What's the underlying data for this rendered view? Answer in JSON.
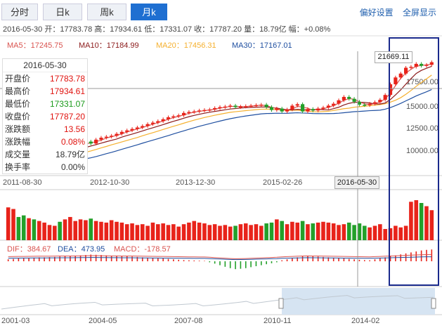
{
  "tabs": [
    {
      "label": "分时",
      "active": false
    },
    {
      "label": "日k",
      "active": false
    },
    {
      "label": "周k",
      "active": false
    },
    {
      "label": "月k",
      "active": true
    }
  ],
  "links": {
    "settings": "偏好设置",
    "fullscreen": "全屏显示"
  },
  "info_line": "2016-05-30 开：17783.78 高：17934.61 低：17331.07 收：17787.20 量：18.79亿 幅：+0.08%",
  "ma": {
    "ma5": "MA5：17245.75",
    "ma10": "MA10：17184.99",
    "ma20": "MA20：17456.31",
    "ma30": "MA30：17167.01"
  },
  "ohlc": {
    "date": "2016-05-30",
    "rows": [
      {
        "label": "开盘价",
        "value": "17783.78",
        "tone": "red"
      },
      {
        "label": "最高价",
        "value": "17934.61",
        "tone": "red"
      },
      {
        "label": "最低价",
        "value": "17331.07",
        "tone": "green"
      },
      {
        "label": "收盘价",
        "value": "17787.20",
        "tone": "red"
      },
      {
        "label": "涨跌额",
        "value": "13.56",
        "tone": "red"
      },
      {
        "label": "涨跌幅",
        "value": "0.08%",
        "tone": "red"
      },
      {
        "label": "成交量",
        "value": "18.79亿",
        "tone": "plain"
      },
      {
        "label": "换手率",
        "value": "0.00%",
        "tone": "plain"
      }
    ]
  },
  "macd": {
    "dif": "DIF：384.67",
    "dea": "DEA：473.95",
    "macd": "MACD：-178.57"
  },
  "cursor_date": "2016-05-30",
  "price_tag": "21669.11",
  "colors": {
    "up": "#e8231a",
    "down": "#23a02a",
    "ma5": "#d9534f",
    "ma10": "#8b1a1a",
    "ma20": "#f5b02e",
    "ma30": "#1f4fa0",
    "highlight": "#1a2a8c",
    "accent": "#1f6fd1"
  },
  "chart_data": {
    "type": "candlestick",
    "y_ticks": [
      "15000.00",
      "12500.00",
      "10000.00",
      "17500.00"
    ],
    "x_ticks": [
      "2011-08-30",
      "2012-10-30",
      "2013-12-30",
      "2015-02-26",
      "2016-05-30"
    ],
    "nav_ticks": [
      "2001-03",
      "2004-05",
      "2007-08",
      "2010-11",
      "2014-02"
    ],
    "ylim": [
      10000,
      22000
    ],
    "closes": [
      11650,
      11700,
      11600,
      11550,
      11900,
      11800,
      12000,
      12150,
      12300,
      12500,
      12450,
      12800,
      13000,
      13100,
      13250,
      13500,
      13300,
      13700,
      13900,
      14000,
      14100,
      14300,
      14500,
      14650,
      14800,
      14950,
      15100,
      15300,
      15450,
      15600,
      15800,
      16000,
      16100,
      16200,
      16450,
      16550,
      16600,
      16700,
      16750,
      16800,
      16950,
      17050,
      17100,
      17200,
      17050,
      17100,
      17150,
      17200,
      17250,
      17300,
      17050,
      16750,
      16900,
      16600,
      16800,
      17200,
      17350,
      16600,
      16850,
      16700,
      16900,
      17000,
      17200,
      17400,
      17750,
      18100,
      17900,
      17600,
      17300,
      17250,
      17400,
      17550,
      17800,
      18300,
      19400,
      20100,
      20500,
      21100,
      21200,
      21500,
      21300,
      21400,
      21669
    ],
    "volumes": [
      0.82,
      0.78,
      0.58,
      0.62,
      0.55,
      0.52,
      0.48,
      0.44,
      0.38,
      0.36,
      0.46,
      0.52,
      0.58,
      0.48,
      0.52,
      0.5,
      0.54,
      0.48,
      0.46,
      0.44,
      0.5,
      0.46,
      0.44,
      0.4,
      0.42,
      0.38,
      0.4,
      0.36,
      0.44,
      0.4,
      0.42,
      0.38,
      0.4,
      0.34,
      0.4,
      0.44,
      0.48,
      0.44,
      0.42,
      0.38,
      0.4,
      0.36,
      0.38,
      0.34,
      0.36,
      0.4,
      0.42,
      0.38,
      0.4,
      0.36,
      0.42,
      0.44,
      0.52,
      0.48,
      0.4,
      0.46,
      0.44,
      0.48,
      0.4,
      0.42,
      0.44,
      0.46,
      0.44,
      0.42,
      0.38,
      0.4,
      0.44,
      0.38,
      0.42,
      0.36,
      0.32,
      0.36,
      0.4,
      0.28,
      0.3,
      0.36,
      0.32,
      0.36,
      0.96,
      1.0,
      0.93,
      0.85,
      0.75
    ],
    "macd_hist": [
      0.1,
      0.12,
      0.14,
      0.15,
      0.16,
      0.18,
      0.2,
      0.2,
      0.21,
      0.22,
      0.24,
      0.25,
      0.26,
      0.28,
      0.3,
      0.32,
      0.34,
      0.33,
      0.32,
      0.3,
      0.28,
      0.27,
      0.26,
      0.25,
      0.24,
      0.22,
      0.2,
      0.18,
      0.17,
      0.15,
      0.14,
      0.12,
      0.1,
      0.08,
      0.06,
      0.05,
      0.04,
      0.03,
      0.02,
      -0.05,
      -0.12,
      -0.2,
      -0.28,
      -0.35,
      -0.4,
      -0.38,
      -0.35,
      -0.3,
      -0.25,
      -0.2,
      -0.15,
      -0.1,
      -0.05,
      0.05,
      0.1,
      0.15,
      0.2,
      0.25,
      0.28,
      0.26,
      0.24,
      0.22,
      0.2,
      0.18,
      0.16,
      0.14,
      0.12,
      0.1,
      0.08,
      0.06,
      0.05,
      0.1,
      0.15,
      0.2,
      0.25,
      0.3,
      0.35,
      0.4,
      0.45,
      0.5,
      0.55,
      0.58,
      0.6
    ]
  }
}
